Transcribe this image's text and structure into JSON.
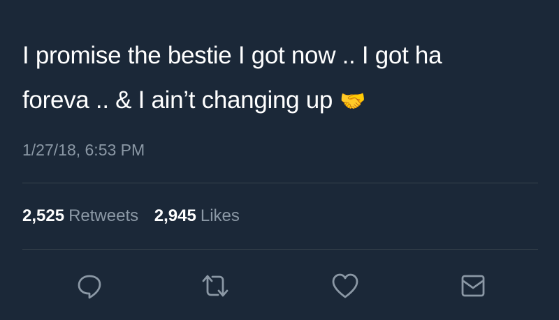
{
  "tweet": {
    "text_line_1": "I promise the bestie I got now .. I got ha",
    "text_line_2": "foreva .. & I ain’t changing up",
    "emoji": "🤝",
    "timestamp": "1/27/18, 6:53 PM"
  },
  "stats": {
    "retweets_count": "2,525",
    "retweets_label": "Retweets",
    "likes_count": "2,945",
    "likes_label": "Likes"
  },
  "actions": {
    "reply_icon": "reply-icon",
    "retweet_icon": "retweet-icon",
    "like_icon": "like-icon",
    "dm_icon": "direct-message-icon"
  },
  "colors": {
    "background": "#1b2838",
    "text": "#ffffff",
    "secondary_text": "#8b98a5",
    "divider": "#38444d",
    "icon": "#8b98a5"
  }
}
